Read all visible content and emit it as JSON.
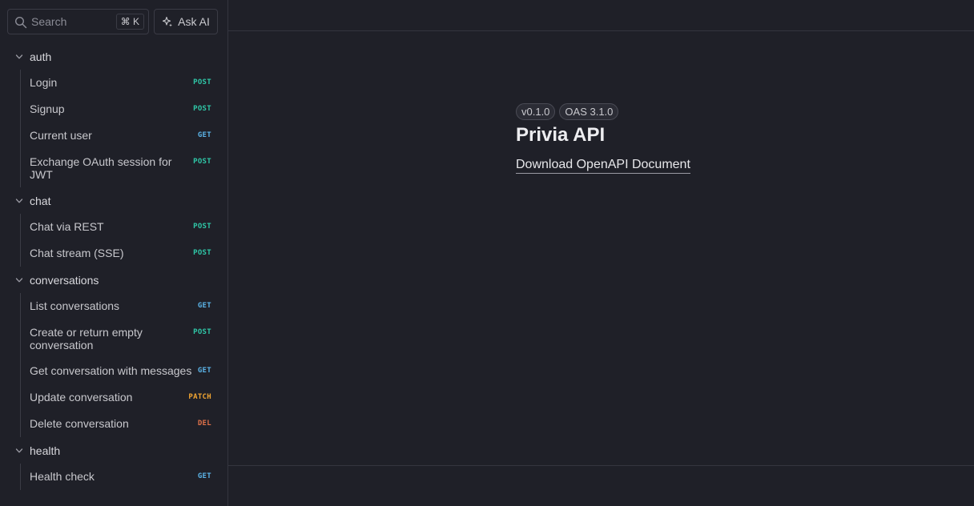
{
  "sidebar": {
    "search": {
      "placeholder": "Search",
      "shortcut": "⌘ K"
    },
    "ask_ai_label": "Ask AI",
    "groups": [
      {
        "name": "auth",
        "items": [
          {
            "label": "Login",
            "method": "POST"
          },
          {
            "label": "Signup",
            "method": "POST"
          },
          {
            "label": "Current user",
            "method": "GET"
          },
          {
            "label": "Exchange OAuth session for JWT",
            "method": "POST"
          }
        ]
      },
      {
        "name": "chat",
        "items": [
          {
            "label": "Chat via REST",
            "method": "POST"
          },
          {
            "label": "Chat stream (SSE)",
            "method": "POST"
          }
        ]
      },
      {
        "name": "conversations",
        "items": [
          {
            "label": "List conversations",
            "method": "GET"
          },
          {
            "label": "Create or return empty conversation",
            "method": "POST"
          },
          {
            "label": "Get conversation with messages",
            "method": "GET"
          },
          {
            "label": "Update conversation",
            "method": "PATCH"
          },
          {
            "label": "Delete conversation",
            "method": "DEL"
          }
        ]
      },
      {
        "name": "health",
        "items": [
          {
            "label": "Health check",
            "method": "GET"
          }
        ]
      }
    ]
  },
  "main": {
    "version_badge": "v0.1.0",
    "oas_badge": "OAS 3.1.0",
    "title": "Privia API",
    "download_link": "Download OpenAPI Document"
  },
  "colors": {
    "background": "#1f2028",
    "post": "#2fc8a8",
    "get": "#5bb4e8",
    "patch": "#f1a532",
    "delete": "#e0724a"
  },
  "icons": {
    "search": "search-icon",
    "ask_ai": "sparkle-icon",
    "group_toggle": "chevron-down-icon"
  }
}
